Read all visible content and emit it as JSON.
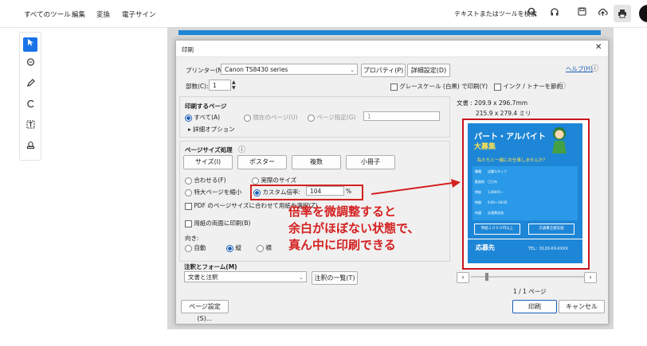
{
  "menu": {
    "all_tools": "すべてのツール",
    "edit": "編集",
    "convert": "変換",
    "esign": "電子サイン"
  },
  "search": {
    "placeholder": "テキストまたはツールを検索"
  },
  "dialog": {
    "title": "印刷",
    "help": "ヘルプ(H)",
    "printer_label": "プリンター(N):",
    "printer_value": "Canon TS8430 series",
    "properties": "プロパティ(P)",
    "advanced": "詳細設定(D)",
    "copies_label": "部数(C):",
    "copies_value": "1",
    "grayscale": "グレースケール (白黒) で印刷(Y)",
    "ink_save": "インク / トナーを節約",
    "pages_title": "印刷するページ",
    "all": "すべて(A)",
    "current": "現在のページ(U)",
    "page_range": "ページ指定(G)",
    "page_range_value": "1",
    "more_options": "▸ 詳細オプション",
    "size_title": "ページサイズ処理",
    "size_btn": "サイズ(I)",
    "poster_btn": "ポスター",
    "multiple_btn": "複数",
    "booklet_btn": "小冊子",
    "fit": "合わせる(F)",
    "actual": "実際のサイズ",
    "shrink": "特大ページを縮小",
    "custom": "カスタム倍率:",
    "custom_value": "104",
    "percent": "%",
    "pdf_paper": "PDF のページサイズに合わせて用紙を選択(Z)",
    "duplex": "用紙の両面に印刷(B)",
    "orient_label": "向き:",
    "auto": "自動",
    "portrait": "縦",
    "landscape": "横",
    "comments_title": "注釈とフォーム(M)",
    "comments_value": "文書と注釈",
    "comments_list": "注釈の一覧(T)",
    "doc_size": "文書 : 209.9 x 296.7mm",
    "paper_size": "215.9 x 279.4 ミリ",
    "page_count": "1 / 1 ページ",
    "page_setup": "ページ設定(S)...",
    "print": "印刷",
    "cancel": "キャンセル"
  },
  "poster": {
    "title": "パート・アルバイト",
    "subtitle": "大募集",
    "tagline": "私たちと一緒にお仕事しませんか？",
    "rows": [
      "職種　　店舗スタッフ",
      "勤務地　〇〇市",
      "時給　　1,000円〜",
      "時間　　9:00〜18:00",
      "待遇　　交通費支給"
    ],
    "badge1": "時給１０００円以上",
    "badge2": "交通費全額支給",
    "apply": "応募先",
    "tel": "TEL：0120-XX-XXXX"
  },
  "annotation": {
    "line1": "倍率を微調整すると",
    "line2": "余白がほぼない状態で、",
    "line3": "真ん中に印刷できる"
  },
  "colors": {
    "accent": "#1a5fb4",
    "highlight": "#d42020",
    "poster_bg": "#1e86d6"
  }
}
